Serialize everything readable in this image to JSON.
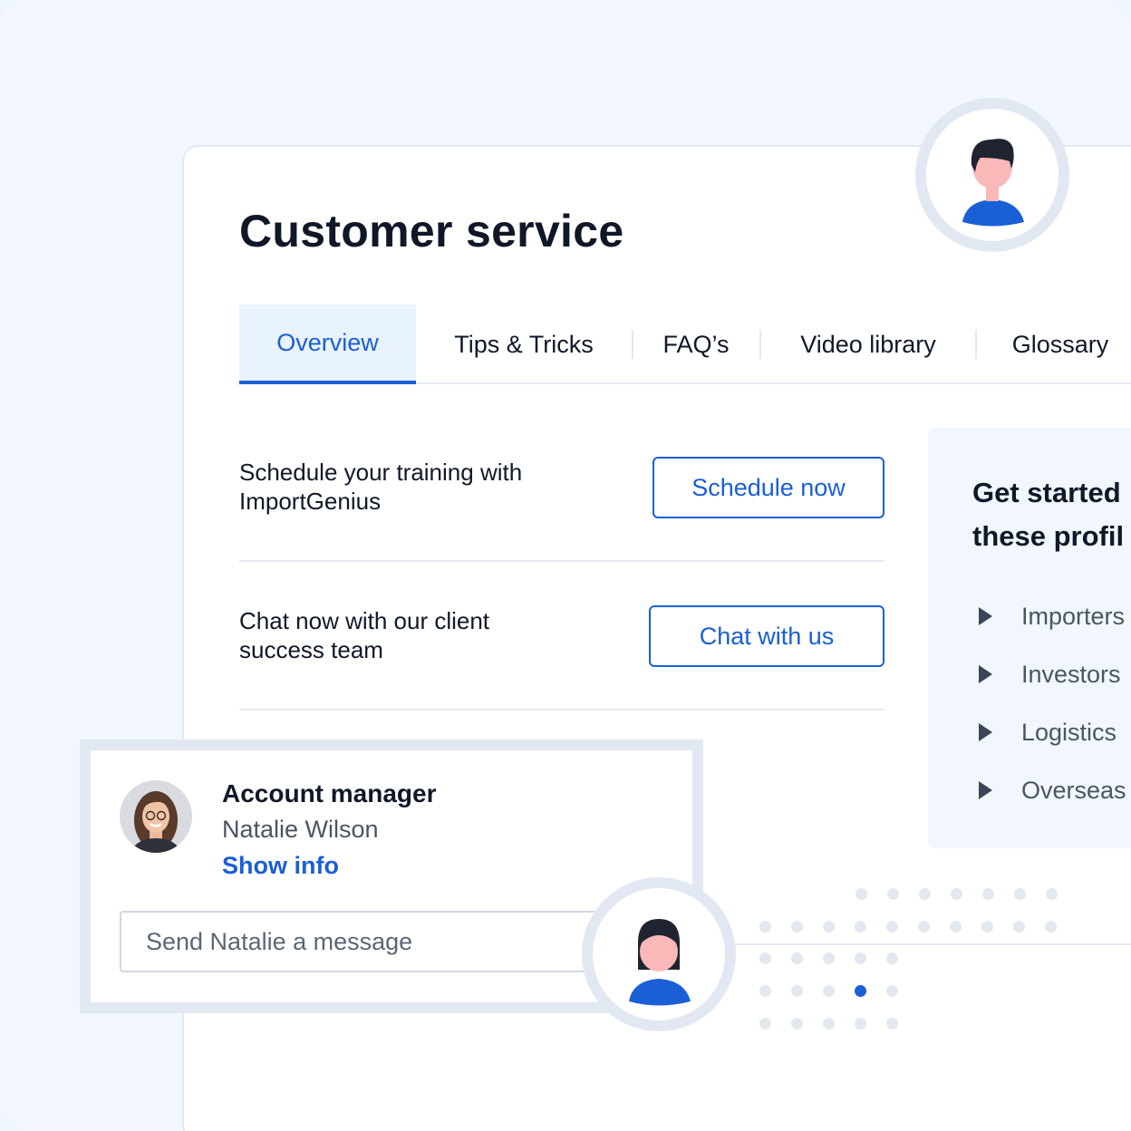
{
  "page": {
    "title": "Customer service"
  },
  "tabs": [
    {
      "label": "Overview",
      "active": true
    },
    {
      "label": "Tips & Tricks"
    },
    {
      "label": "FAQ’s"
    },
    {
      "label": "Video library"
    },
    {
      "label": "Glossary"
    }
  ],
  "rows": [
    {
      "text": "Schedule your training with ImportGenius",
      "button": "Schedule now"
    },
    {
      "text": "Chat now with our client success team",
      "button": "Chat with us"
    }
  ],
  "side_panel": {
    "title_line1": "Get started",
    "title_line2": "these profil",
    "items": [
      "Importers",
      "Investors",
      "Logistics",
      "Overseas"
    ]
  },
  "account_manager": {
    "role": "Account manager",
    "name": "Natalie Wilson",
    "link": "Show info",
    "message_placeholder": "Send Natalie a message"
  },
  "icons": {
    "male_avatar": "user-male-icon",
    "female_avatar": "user-female-icon",
    "bullet": "triangle-right-icon"
  },
  "colors": {
    "accent": "#1a5fd6",
    "text": "#101828",
    "muted": "#4b5563",
    "skin": "#fbb8b8",
    "hair": "#1f2430"
  }
}
